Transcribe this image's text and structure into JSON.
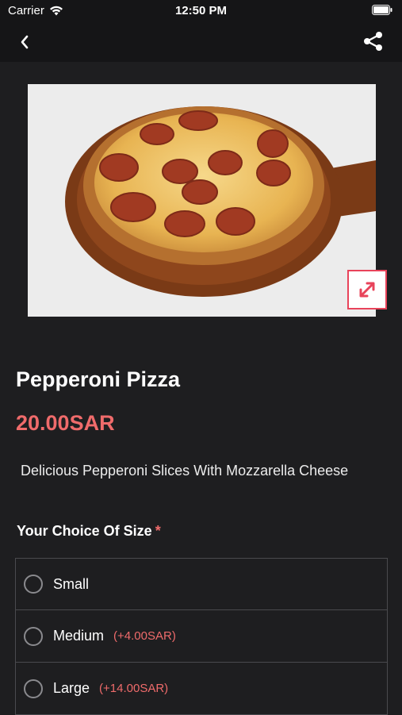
{
  "status_bar": {
    "carrier": "Carrier",
    "time": "12:50 PM"
  },
  "nav": {
    "back_icon": "chevron-left-icon",
    "share_icon": "share-icon"
  },
  "product": {
    "title": "Pepperoni Pizza",
    "price": "20.00SAR",
    "description": "Delicious Pepperoni Slices With Mozzarella Cheese"
  },
  "size_section": {
    "title": "Your Choice Of Size",
    "required_mark": "*",
    "options": [
      {
        "label": "Small",
        "extra": ""
      },
      {
        "label": "Medium",
        "extra": "(+4.00SAR)"
      },
      {
        "label": "Large",
        "extra": "(+14.00SAR)"
      }
    ]
  },
  "colors": {
    "accent": "#ef6b6b",
    "background": "#1e1e20",
    "header": "#151517"
  }
}
